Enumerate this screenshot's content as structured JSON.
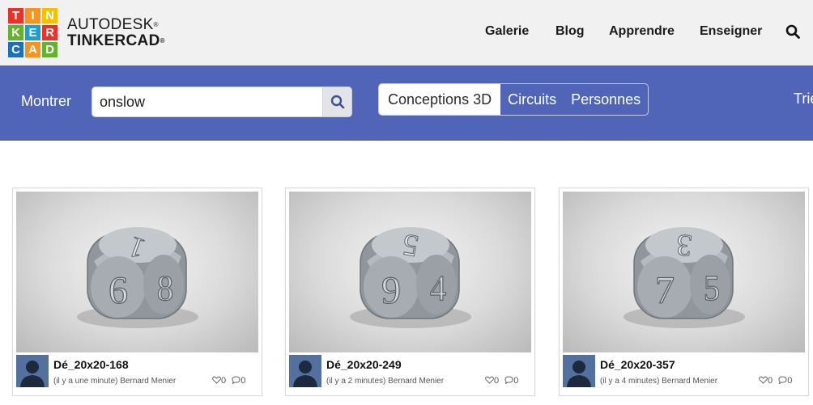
{
  "logo": {
    "letters": [
      "T",
      "I",
      "N",
      "K",
      "E",
      "R",
      "C",
      "A",
      "D"
    ],
    "colors": [
      "#e8332a",
      "#f7941d",
      "#f2c200",
      "#65b22e",
      "#1aa0d8",
      "#e8332a",
      "#1d6fb8",
      "#f7941d",
      "#65b22e"
    ]
  },
  "brand": {
    "line1": "AUTODESK",
    "line2": "TINKERCAD",
    "mark": "®"
  },
  "nav": {
    "gallery": "Galerie",
    "blog": "Blog",
    "learn": "Apprendre",
    "teach": "Enseigner",
    "search_icon": "search-icon"
  },
  "filter": {
    "show_label": "Montrer",
    "search_value": "onslow",
    "search_icon": "search-icon",
    "tabs": [
      "Conceptions 3D",
      "Circuits",
      "Personnes"
    ],
    "active_tab": "Conceptions 3D",
    "sort_label": "Trier"
  },
  "colors": {
    "header_bg": "#f1f1f2",
    "bar_bg": "#5064b8"
  },
  "cards": [
    {
      "title": "Dé_20x20-168",
      "meta": "(il y a une minute) Bernard Menier",
      "likes": "0",
      "comments": "0",
      "faces": [
        "1",
        "6",
        "8"
      ]
    },
    {
      "title": "Dé_20x20-249",
      "meta": "(il y a 2 minutes) Bernard Menier",
      "likes": "0",
      "comments": "0",
      "faces": [
        "5",
        "9",
        "4"
      ]
    },
    {
      "title": "Dé_20x20-357",
      "meta": "(il y a 4 minutes) Bernard Menier",
      "likes": "0",
      "comments": "0",
      "faces": [
        "3",
        "7",
        "5"
      ]
    }
  ]
}
